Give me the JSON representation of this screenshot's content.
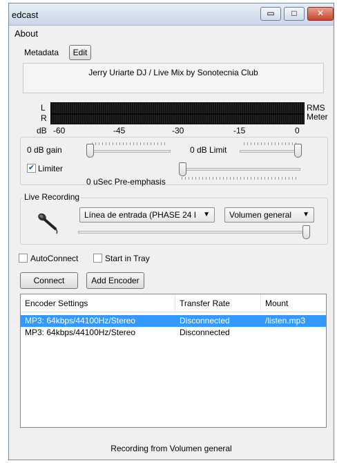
{
  "window": {
    "title": "edcast",
    "controls": {
      "minimize": "▭",
      "maximize": "□",
      "close": "✕"
    }
  },
  "menu": {
    "about": "About"
  },
  "metadata": {
    "label": "Metadata",
    "edit_button": "Edit",
    "current": "Jerry Uriarte DJ / Live Mix by Sonotecnia Club"
  },
  "meter": {
    "left_label": "L",
    "right_label": "R",
    "rms_label": "RMS",
    "meter_label": "Meter",
    "db_label": "dB",
    "scale": [
      "-60",
      "-45",
      "-30",
      "-15",
      "0"
    ]
  },
  "controls": {
    "gain_label": "0 dB gain",
    "limit_label": "0 dB Limit",
    "limiter_label": "Limiter",
    "limiter_checked": true,
    "preemphasis_label": "0  uSec Pre-emphasis",
    "gain_level": 0.0,
    "limit_level": 1.0,
    "preemphasis_level": 0.0
  },
  "live_recording": {
    "label": "Live Recording",
    "input_select": "Línea de entrada (PHASE 24 I",
    "volume_select": "Volumen general",
    "volume_level": 1.0,
    "microphone_icon": "microphone-icon"
  },
  "options": {
    "autoconnect_label": "AutoConnect",
    "autoconnect_checked": false,
    "start_in_tray_label": "Start in Tray",
    "start_in_tray_checked": false
  },
  "buttons": {
    "connect": "Connect",
    "add_encoder": "Add Encoder"
  },
  "encoders": {
    "columns": [
      "Encoder Settings",
      "Transfer Rate",
      "Mount"
    ],
    "rows": [
      {
        "settings": "MP3: 64kbps/44100Hz/Stereo",
        "rate": "Disconnected",
        "mount": "/listen.mp3",
        "selected": true
      },
      {
        "settings": "MP3: 64kbps/44100Hz/Stereo",
        "rate": "Disconnected",
        "mount": "",
        "selected": false
      }
    ]
  },
  "status": "Recording from Volumen general",
  "colors": {
    "selection": "#3399ff",
    "meter_bg": "#111111"
  }
}
